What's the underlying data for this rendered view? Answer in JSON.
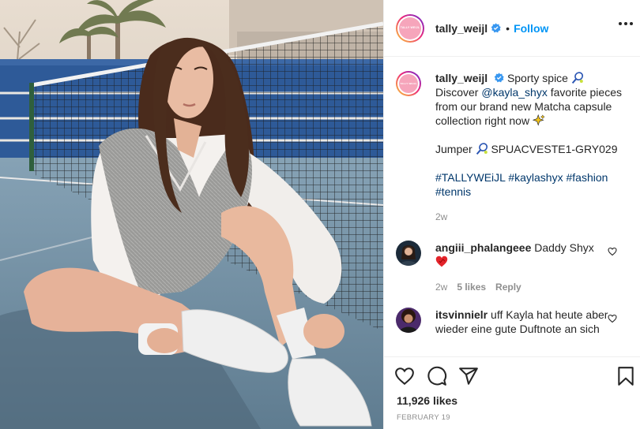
{
  "account": {
    "username": "tally_weijl",
    "avatar_text": "TALLY WEIJL",
    "follow_label": "Follow",
    "separator": "•"
  },
  "caption": {
    "username": "tally_weijl",
    "line1": "Sporty spice",
    "discover": "Discover ",
    "mention": "@kayla_shyx",
    "line1_rest": " favorite pieces from our brand new Matcha capsule collection right now",
    "jumper_label": "Jumper",
    "sku": "SPUACVESTE1-GRY029",
    "hashtags": [
      "#TALLYWEiJL",
      "#kaylashyx",
      "#fashion",
      "#tennis"
    ],
    "time": "2w"
  },
  "comments": [
    {
      "username": "angiii_phalangeee",
      "text": "Daddy Shyx",
      "time": "2w",
      "likes": "5 likes",
      "reply": "Reply"
    },
    {
      "username": "itsvinnielr",
      "text": "uff Kayla hat heute aber wieder eine gute Duftnote an sich"
    }
  ],
  "footer": {
    "likes": "11,926 likes",
    "date": "FEBRUARY 19"
  },
  "colors": {
    "link": "#0095f6",
    "hashtag": "#00376b",
    "muted": "#8e8e8e",
    "text": "#262626"
  },
  "icons": [
    "verified-badge-icon",
    "more-options-icon",
    "tennis-racket-emoji",
    "sparkles-emoji",
    "heart-emoji",
    "heart-icon",
    "comment-icon",
    "share-icon",
    "bookmark-icon"
  ]
}
